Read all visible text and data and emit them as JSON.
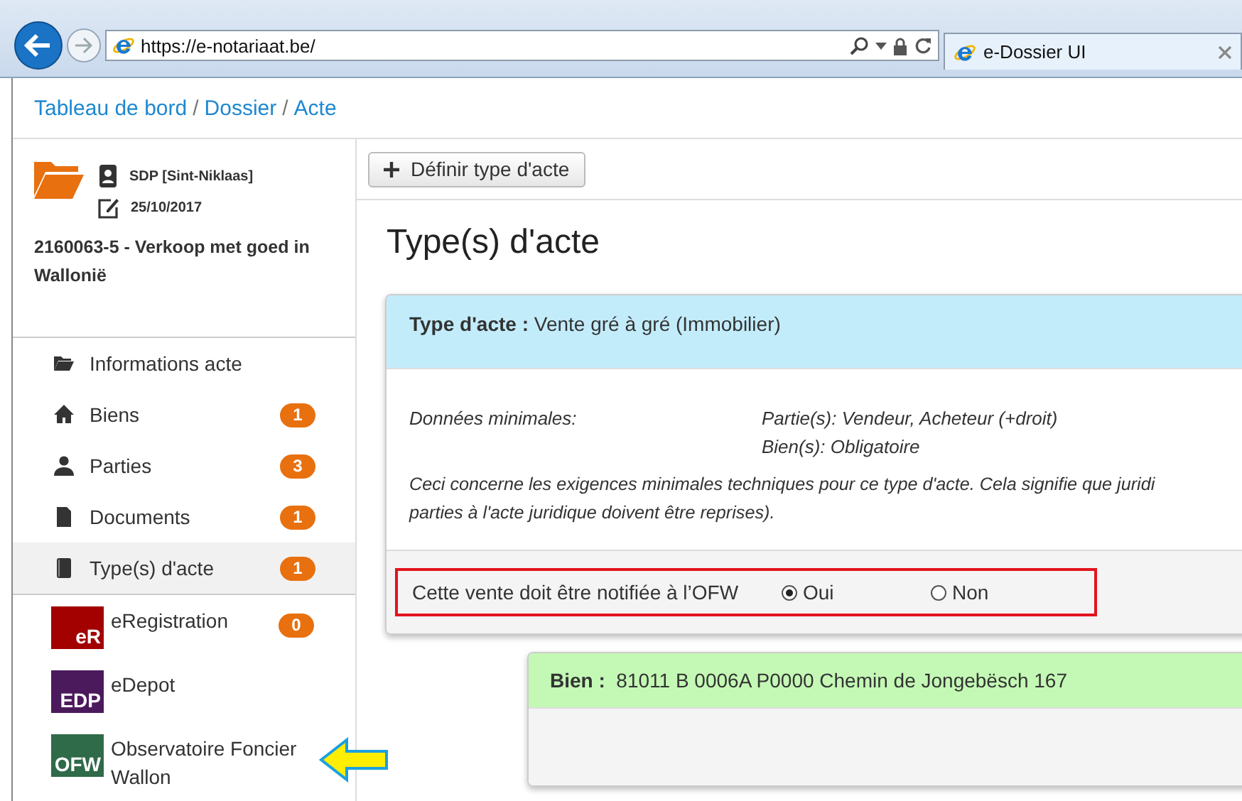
{
  "browser": {
    "address": "https://e-notariaat.be/",
    "tab": "e-Dossier UI"
  },
  "breadcrumb": {
    "items": [
      "Tableau de bord",
      "Dossier",
      "Acte"
    ],
    "separator": "/"
  },
  "dossier": {
    "office": "SDP [Sint-Niklaas]",
    "date": "25/10/2017",
    "title": "2160063-5 - Verkoop met goed in Wallonië"
  },
  "sidebar": {
    "items": [
      {
        "kind": "folder",
        "label": "Informations acte",
        "selected": false
      },
      {
        "kind": "home",
        "label": "Biens",
        "badge": "1",
        "selected": false
      },
      {
        "kind": "person",
        "label": "Parties",
        "badge": "3",
        "selected": false
      },
      {
        "kind": "document",
        "label": "Documents",
        "badge": "1",
        "selected": false
      },
      {
        "kind": "book",
        "label": "Type(s) d'acte",
        "badge": "1",
        "selected": true
      }
    ],
    "services": [
      {
        "logo": "eR",
        "label": "eRegistration",
        "color": "#a30000",
        "badge": "0"
      },
      {
        "logo": "EDP",
        "label": "eDepot",
        "color": "#4b1a5c"
      },
      {
        "logo": "OFW",
        "label": "Observatoire Foncier Wallon",
        "color": "#2f6a49"
      }
    ]
  },
  "toolbar": {
    "button": "Définir type d'acte"
  },
  "heading": "Type(s) d'acte",
  "act_card": {
    "label": "Type d'acte :",
    "value": "Vente gré à gré (Immobilier)",
    "minimal_label": "Données minimales:",
    "requirements": [
      "Partie(s): Vendeur, Acheteur (+droit)",
      "Bien(s): Obligatoire"
    ],
    "note_lines": [
      "Ceci concerne les exigences minimales techniques pour ce type d'acte. Cela signifie que juridi",
      "parties à l'acte juridique doivent être reprises)."
    ],
    "question": "Cette vente doit être notifiée à l’OFW",
    "options": [
      {
        "label": "Oui",
        "selected": true
      },
      {
        "label": "Non",
        "selected": false
      }
    ]
  },
  "property_card": {
    "label": "Bien :",
    "value": "81011 B 0006A P0000 Chemin de Jongebësch 167"
  }
}
